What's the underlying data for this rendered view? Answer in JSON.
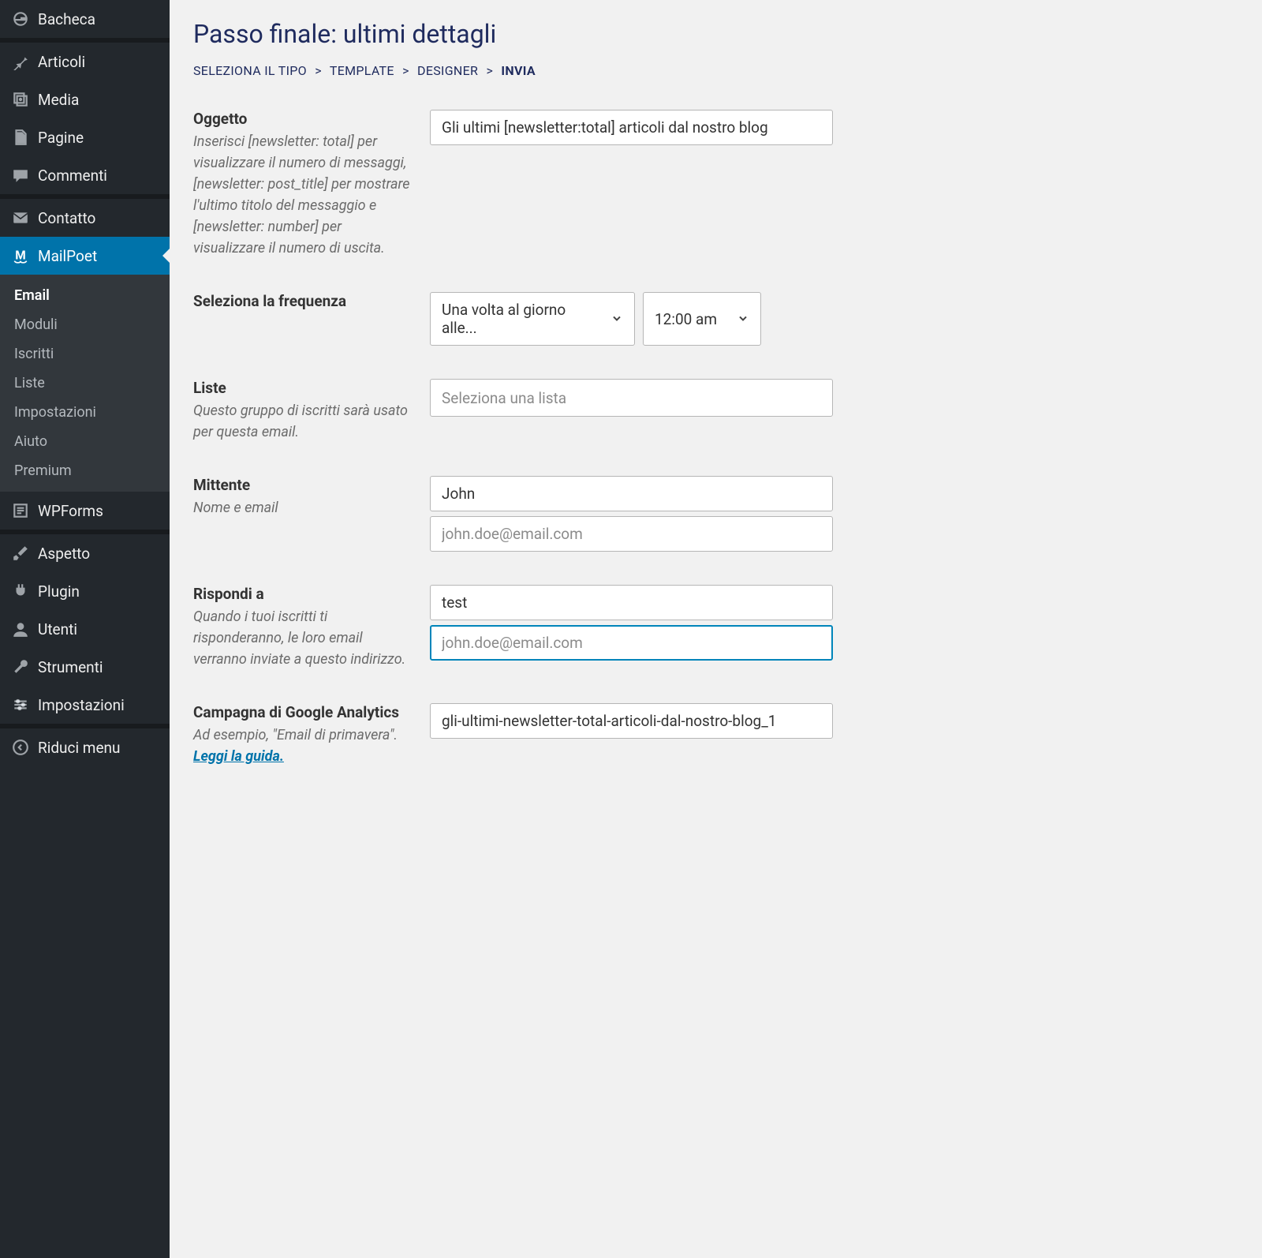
{
  "sidebar": {
    "items": [
      {
        "label": "Bacheca",
        "icon": "dashboard"
      },
      {
        "label": "Articoli",
        "icon": "pin"
      },
      {
        "label": "Media",
        "icon": "media"
      },
      {
        "label": "Pagine",
        "icon": "pages"
      },
      {
        "label": "Commenti",
        "icon": "comment"
      },
      {
        "label": "Contatto",
        "icon": "mail"
      },
      {
        "label": "MailPoet",
        "icon": "mailpoet",
        "current": true
      },
      {
        "label": "WPForms",
        "icon": "form"
      },
      {
        "label": "Aspetto",
        "icon": "brush"
      },
      {
        "label": "Plugin",
        "icon": "plug"
      },
      {
        "label": "Utenti",
        "icon": "user"
      },
      {
        "label": "Strumenti",
        "icon": "wrench"
      },
      {
        "label": "Impostazioni",
        "icon": "sliders"
      },
      {
        "label": "Riduci menu",
        "icon": "collapse"
      }
    ],
    "submenu": [
      "Email",
      "Moduli",
      "Iscritti",
      "Liste",
      "Impostazioni",
      "Aiuto",
      "Premium"
    ]
  },
  "page": {
    "title": "Passo finale: ultimi dettagli",
    "breadcrumb": [
      "SELEZIONA IL TIPO",
      "TEMPLATE",
      "DESIGNER",
      "INVIA"
    ]
  },
  "form": {
    "subject": {
      "label": "Oggetto",
      "hint": "Inserisci [newsletter: total] per visualizzare il numero di messaggi, [newsletter: post_title] per mostrare l'ultimo titolo del messaggio e [newsletter: number] per visualizzare il numero di uscita.",
      "value": "Gli ultimi [newsletter:total] articoli dal nostro blog"
    },
    "frequency": {
      "label": "Seleziona la frequenza",
      "interval_selected": "Una volta al giorno alle...",
      "time_selected": "12:00 am"
    },
    "lists": {
      "label": "Liste",
      "hint": "Questo gruppo di iscritti sarà usato per questa email.",
      "placeholder": "Seleziona una lista"
    },
    "sender": {
      "label": "Mittente",
      "hint": "Nome e email",
      "name_value": "John",
      "email_placeholder": "john.doe@email.com"
    },
    "reply_to": {
      "label": "Rispondi a",
      "hint": "Quando i tuoi iscritti ti risponderanno, le loro email verranno inviate a questo indirizzo.",
      "name_value": "test",
      "email_placeholder": "john.doe@email.com"
    },
    "ga": {
      "label": "Campagna di Google Analytics",
      "hint_prefix": "Ad esempio, \"Email di primavera\". ",
      "hint_link": "Leggi la guida.",
      "value": "gli-ultimi-newsletter-total-articoli-dal-nostro-blog_1"
    }
  }
}
